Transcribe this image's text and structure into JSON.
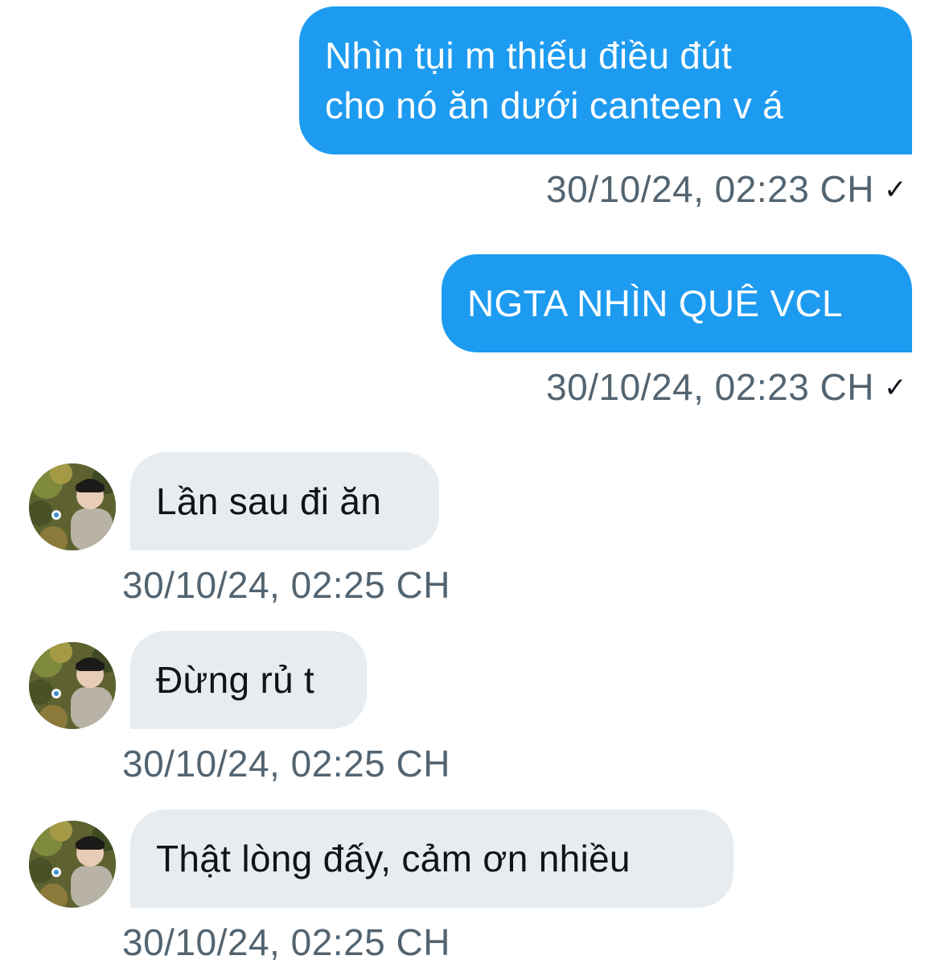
{
  "conversation": {
    "messages": [
      {
        "direction": "sent",
        "lines": [
          "Nhìn tụi m thiếu điều đút",
          "cho nó ăn dưới canteen v á"
        ],
        "timestamp": "30/10/24, 02:23 CH",
        "status_icon": "checkmark-icon",
        "status_glyph": "✓"
      },
      {
        "direction": "sent",
        "lines": [
          "NGTA NHÌN QUÊ VCL"
        ],
        "timestamp": "30/10/24, 02:23 CH",
        "status_icon": "checkmark-icon",
        "status_glyph": "✓"
      },
      {
        "direction": "received",
        "lines": [
          "Lần sau đi ăn"
        ],
        "timestamp": "30/10/24, 02:25 CH",
        "avatar": "user-avatar"
      },
      {
        "direction": "received",
        "lines": [
          "Đừng rủ t"
        ],
        "timestamp": "30/10/24, 02:25 CH",
        "avatar": "user-avatar"
      },
      {
        "direction": "received",
        "lines": [
          "Thật lòng đấy, cảm ơn nhiều"
        ],
        "timestamp": "30/10/24, 02:25 CH",
        "avatar": "user-avatar"
      }
    ]
  },
  "colors": {
    "sent_bubble": "#1d9bf0",
    "received_bubble": "#e7ecf0",
    "timestamp_text": "#536471",
    "primary_text": "#0f1419"
  }
}
